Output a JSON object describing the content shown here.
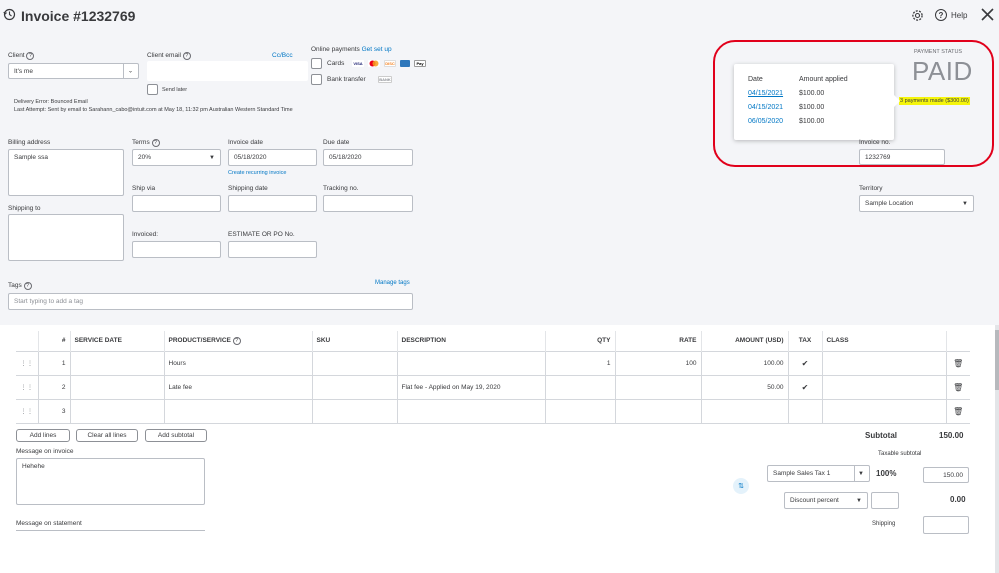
{
  "header": {
    "title": "Invoice #1232769",
    "help_label": "Help"
  },
  "client": {
    "label": "Client",
    "value": "It's me",
    "email_label": "Client email",
    "email_value": "",
    "cc_bcc": "Cc/Bcc",
    "send_later": "Send later",
    "delivery_error": "Delivery Error: Bounced Email",
    "last_attempt": "Last Attempt: Sent by email to Sarahann_cabo@intuit.com at May 18, 11:32 pm Australian Western Standard Time"
  },
  "online_payments": {
    "label": "Online payments",
    "setup_link": "Get set up",
    "cards_label": "Cards",
    "bank_label": "Bank transfer",
    "card_logos": [
      "VISA",
      "MC",
      "DISC",
      "AMEX",
      "Pay"
    ],
    "bank_logo": "BANK"
  },
  "payment_status": {
    "label": "PAYMENT STATUS",
    "value": "PAID",
    "summary": "3 payments made ($300.00)",
    "col_date": "Date",
    "col_amount": "Amount applied",
    "payments": [
      {
        "date": "04/15/2021",
        "amount": "$100.00"
      },
      {
        "date": "04/15/2021",
        "amount": "$100.00"
      },
      {
        "date": "06/05/2020",
        "amount": "$100.00"
      }
    ],
    "highlight_color": "#f5f50b",
    "circle_color": "#e1001b"
  },
  "form": {
    "billing_label": "Billing address",
    "billing_value": "Sample ssa",
    "shipping_label": "Shipping to",
    "shipping_value": "",
    "terms_label": "Terms",
    "terms_value": "20%",
    "invoice_date_label": "Invoice date",
    "invoice_date_value": "05/18/2020",
    "recurring_link": "Create recurring invoice",
    "due_date_label": "Due date",
    "due_date_value": "05/18/2020",
    "ship_via_label": "Ship via",
    "shipping_date_label": "Shipping date",
    "tracking_label": "Tracking no.",
    "invoiced_label": "Invoiced:",
    "estimate_label": "ESTIMATE OR PO No.",
    "invoice_no_label": "Invoice no.",
    "invoice_no_value": "1232769",
    "territory_label": "Territory",
    "territory_value": "Sample Location",
    "tags_label": "Tags",
    "tags_placeholder": "Start typing to add a tag",
    "manage_tags": "Manage tags"
  },
  "lines": {
    "headers": [
      "#",
      "SERVICE DATE",
      "PRODUCT/SERVICE",
      "SKU",
      "DESCRIPTION",
      "QTY",
      "RATE",
      "AMOUNT (USD)",
      "TAX",
      "CLASS"
    ],
    "rows": [
      {
        "num": "1",
        "service_date": "",
        "product": "Hours",
        "sku": "",
        "description": "",
        "qty": "1",
        "rate": "100",
        "amount": "100.00",
        "tax": "✔",
        "class": ""
      },
      {
        "num": "2",
        "service_date": "",
        "product": "Late fee",
        "sku": "",
        "description": "Flat fee - Applied on May 19, 2020",
        "qty": "",
        "rate": "",
        "amount": "50.00",
        "tax": "✔",
        "class": ""
      },
      {
        "num": "3",
        "service_date": "",
        "product": "",
        "sku": "",
        "description": "",
        "qty": "",
        "rate": "",
        "amount": "",
        "tax": "",
        "class": ""
      }
    ]
  },
  "actions": {
    "add_lines": "Add lines",
    "clear_lines": "Clear all lines",
    "add_subtotal": "Add subtotal"
  },
  "messages": {
    "invoice_label": "Message on invoice",
    "invoice_value": "Hehehe",
    "statement_label": "Message on statement"
  },
  "totals": {
    "subtotal_label": "Subtotal",
    "subtotal_value": "150.00",
    "taxable_label": "Taxable subtotal",
    "tax_select": "Sample Sales Tax 1",
    "tax_rate": "100%",
    "tax_amount": "150.00",
    "discount_select": "Discount percent",
    "discount_value": "0.00",
    "shipping_label": "Shipping"
  }
}
